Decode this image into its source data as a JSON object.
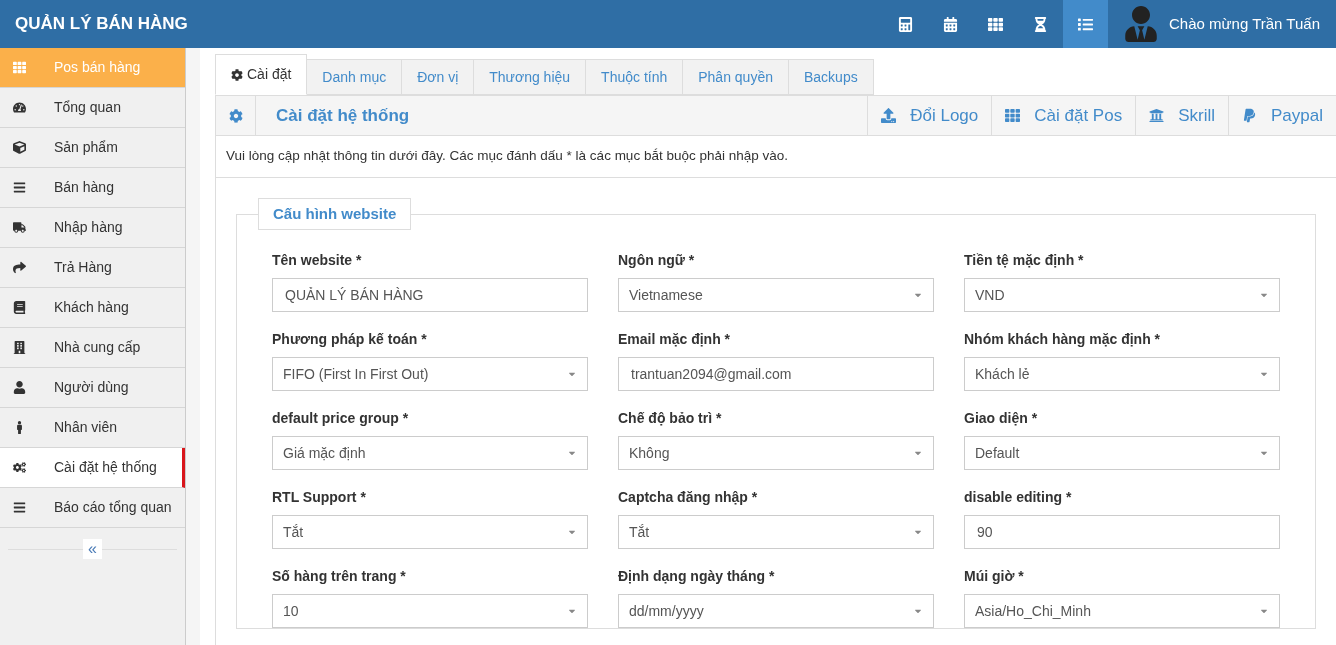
{
  "header": {
    "title": "QUẢN LÝ BÁN HÀNG",
    "toolbar": [
      {
        "selected": false
      },
      {
        "selected": false
      },
      {
        "selected": false
      },
      {
        "selected": false
      },
      {
        "selected": true
      }
    ],
    "greeting": "Chào mừng Trần Tuấn"
  },
  "sidebar": {
    "items": [
      {
        "label": "Pos bán hàng",
        "kind": "highlight",
        "selected": false
      },
      {
        "label": "Tổng quan",
        "kind": "item",
        "selected": false
      },
      {
        "label": "Sản phẩm",
        "kind": "item",
        "selected": false
      },
      {
        "label": "Bán hàng",
        "kind": "item",
        "selected": false
      },
      {
        "label": "Nhập hàng",
        "kind": "item",
        "selected": false
      },
      {
        "label": "Trả Hàng",
        "kind": "item",
        "selected": false
      },
      {
        "label": "Khách hàng",
        "kind": "item",
        "selected": false
      },
      {
        "label": "Nhà cung cấp",
        "kind": "item",
        "selected": false
      },
      {
        "label": "Người dùng",
        "kind": "item",
        "selected": false
      },
      {
        "label": "Nhân viên",
        "kind": "item",
        "selected": false
      },
      {
        "label": "Cài đặt hệ thống",
        "kind": "item",
        "selected": true
      },
      {
        "label": "Báo cáo tổng quan",
        "kind": "item",
        "selected": false
      }
    ],
    "collapse": "«"
  },
  "tabs": [
    {
      "label": "Cài đặt",
      "selected": true
    },
    {
      "label": "Danh mục",
      "selected": false
    },
    {
      "label": "Đơn vị",
      "selected": false
    },
    {
      "label": "Thương hiệu",
      "selected": false
    },
    {
      "label": "Thuộc tính",
      "selected": false
    },
    {
      "label": "Phân quyền",
      "selected": false
    },
    {
      "label": "Backups",
      "selected": false
    }
  ],
  "panel": {
    "title": "Cài đặt hệ thống",
    "actions": [
      {
        "label": "Đổi Logo"
      },
      {
        "label": "Cài đặt Pos"
      },
      {
        "label": "Skrill"
      },
      {
        "label": "Paypal"
      }
    ],
    "intro": "Vui lòng cập nhật thông tin dưới đây. Các mục đánh dấu * là các mục bắt buộc phải nhập vào.",
    "section": "Cấu hình website",
    "fields": [
      {
        "label": "Tên website *",
        "kind": "text",
        "value": "QUẢN LÝ BÁN HÀNG"
      },
      {
        "label": "Ngôn ngữ *",
        "kind": "select",
        "value": "Vietnamese"
      },
      {
        "label": "Tiền tệ mặc định *",
        "kind": "select",
        "value": "VND"
      },
      {
        "label": "Phương pháp kế toán *",
        "kind": "select",
        "value": "FIFO (First In First Out)"
      },
      {
        "label": "Email mặc định *",
        "kind": "text",
        "value": "trantuan2094@gmail.com"
      },
      {
        "label": "Nhóm khách hàng mặc định *",
        "kind": "select",
        "value": "Khách lẻ"
      },
      {
        "label": "default price group *",
        "kind": "select",
        "value": "Giá mặc định"
      },
      {
        "label": "Chế độ bảo trì *",
        "kind": "select",
        "value": "Không"
      },
      {
        "label": "Giao diện *",
        "kind": "select",
        "value": "Default"
      },
      {
        "label": "RTL Support *",
        "kind": "select",
        "value": "Tắt"
      },
      {
        "label": "Captcha đăng nhập *",
        "kind": "select",
        "value": "Tắt"
      },
      {
        "label": "disable editing *",
        "kind": "text",
        "value": "90"
      },
      {
        "label": "Số hàng trên trang *",
        "kind": "select",
        "value": "10"
      },
      {
        "label": "Định dạng ngày tháng *",
        "kind": "select",
        "value": "dd/mm/yyyy"
      },
      {
        "label": "Múi giờ *",
        "kind": "select",
        "value": "Asia/Ho_Chi_Minh"
      }
    ]
  }
}
